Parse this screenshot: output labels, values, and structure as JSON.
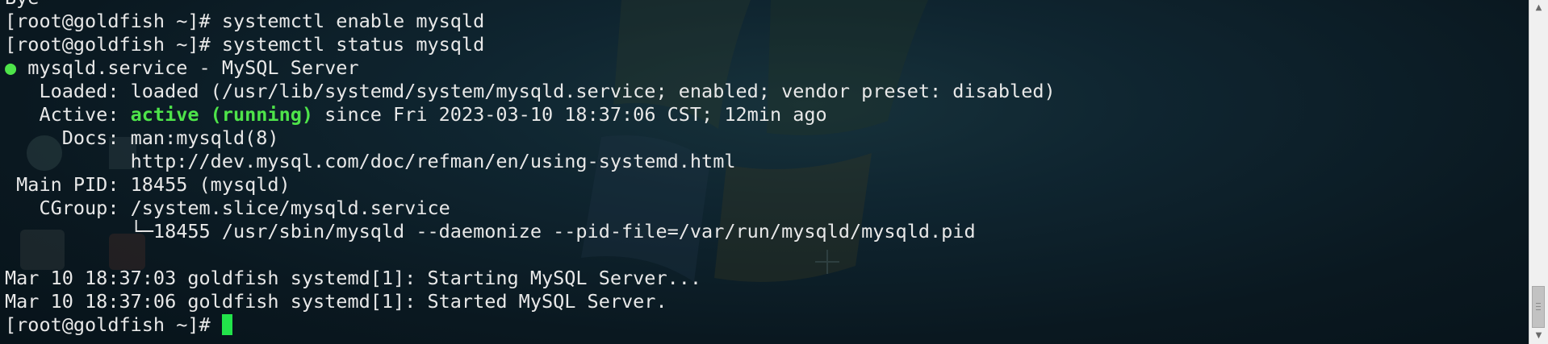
{
  "terminal": {
    "lines": [
      {
        "prefix": "",
        "highlight": "",
        "rest": "Bye"
      },
      {
        "prefix": "",
        "highlight": "",
        "rest": "[root@goldfish ~]# systemctl enable mysqld"
      },
      {
        "prefix": "",
        "highlight": "",
        "rest": "[root@goldfish ~]# systemctl status mysqld"
      },
      {
        "prefix": "●",
        "highlight": "",
        "rest": " mysqld.service - MySQL Server"
      },
      {
        "prefix": "",
        "highlight": "",
        "rest": "   Loaded: loaded (/usr/lib/systemd/system/mysqld.service; enabled; vendor preset: disabled)"
      },
      {
        "prefix": "   Active: ",
        "highlight": "active (running)",
        "rest": " since Fri 2023-03-10 18:37:06 CST; 12min ago"
      },
      {
        "prefix": "",
        "highlight": "",
        "rest": "     Docs: man:mysqld(8)"
      },
      {
        "prefix": "",
        "highlight": "",
        "rest": "           http://dev.mysql.com/doc/refman/en/using-systemd.html"
      },
      {
        "prefix": "",
        "highlight": "",
        "rest": " Main PID: 18455 (mysqld)"
      },
      {
        "prefix": "",
        "highlight": "",
        "rest": "   CGroup: /system.slice/mysqld.service"
      },
      {
        "prefix": "",
        "highlight": "",
        "rest": "           └─18455 /usr/sbin/mysqld --daemonize --pid-file=/var/run/mysqld/mysqld.pid"
      },
      {
        "prefix": "",
        "highlight": "",
        "rest": ""
      },
      {
        "prefix": "",
        "highlight": "",
        "rest": "Mar 10 18:37:03 goldfish systemd[1]: Starting MySQL Server..."
      },
      {
        "prefix": "",
        "highlight": "",
        "rest": "Mar 10 18:37:06 goldfish systemd[1]: Started MySQL Server."
      }
    ],
    "prompt": "[root@goldfish ~]# "
  },
  "scrollbar": {
    "up_arrow_icon": "triangle-up",
    "down_arrow_icon": "triangle-down"
  },
  "colors": {
    "background": "#0b1a22",
    "text": "#e8e8e8",
    "status_green": "#4ee44a",
    "cursor": "#22e34a"
  }
}
